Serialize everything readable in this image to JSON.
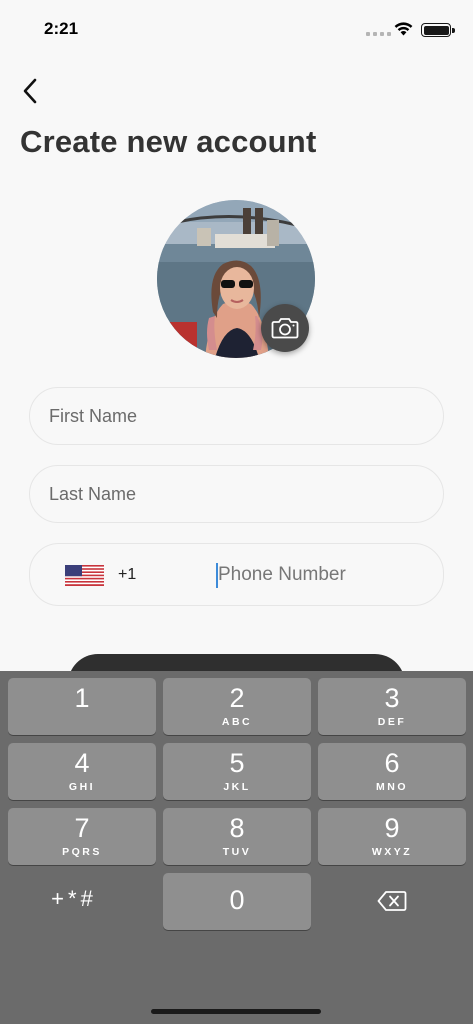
{
  "status_bar": {
    "time": "2:21"
  },
  "header": {
    "title": "Create new account"
  },
  "form": {
    "first_name_placeholder": "First Name",
    "last_name_placeholder": "Last Name",
    "country_code": "+1",
    "country_flag": "us-flag",
    "phone_placeholder": "Phone Number"
  },
  "keypad": {
    "keys": [
      {
        "num": "1",
        "letters": ""
      },
      {
        "num": "2",
        "letters": "ABC"
      },
      {
        "num": "3",
        "letters": "DEF"
      },
      {
        "num": "4",
        "letters": "GHI"
      },
      {
        "num": "5",
        "letters": "JKL"
      },
      {
        "num": "6",
        "letters": "MNO"
      },
      {
        "num": "7",
        "letters": "PQRS"
      },
      {
        "num": "8",
        "letters": "TUV"
      },
      {
        "num": "9",
        "letters": "WXYZ"
      },
      {
        "num": "+*#",
        "letters": ""
      },
      {
        "num": "0",
        "letters": ""
      }
    ]
  },
  "colors": {
    "accent_caret": "#3d8bd9",
    "keypad_bg": "#6b6b6b",
    "key_bg": "#8f8f8f"
  }
}
